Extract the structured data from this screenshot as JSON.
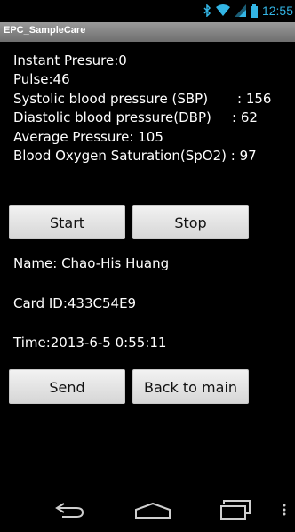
{
  "status_bar": {
    "time": "12:55",
    "icons": [
      "bluetooth-icon",
      "wifi-icon",
      "signal-icon",
      "battery-icon"
    ]
  },
  "app": {
    "title": "EPC_SampleCare"
  },
  "readings": [
    {
      "label": "Instant Presure:0",
      "value": ""
    },
    {
      "label": "Pulse:46",
      "value": ""
    },
    {
      "label": "Systolic blood pressure (SBP)",
      "value": ": 156"
    },
    {
      "label": "Diastolic blood pressure(DBP)",
      "value": ": 62"
    },
    {
      "label": "Average Pressure: 105",
      "value": ""
    },
    {
      "label": "Blood Oxygen Saturation(SpO2) : 97",
      "value": ""
    }
  ],
  "buttons": {
    "start": "Start",
    "stop": "Stop",
    "send": "Send",
    "back": "Back to main"
  },
  "patient": {
    "name": "Name: Chao-His Huang",
    "card_id": "Card ID:433C54E9",
    "time": "Time:2013-6-5 0:55:11"
  },
  "nav": {
    "icons": [
      "back-icon",
      "home-icon",
      "recent-apps-icon",
      "menu-icon"
    ]
  },
  "colors": {
    "accent": "#33b5e5",
    "background": "#000000"
  }
}
